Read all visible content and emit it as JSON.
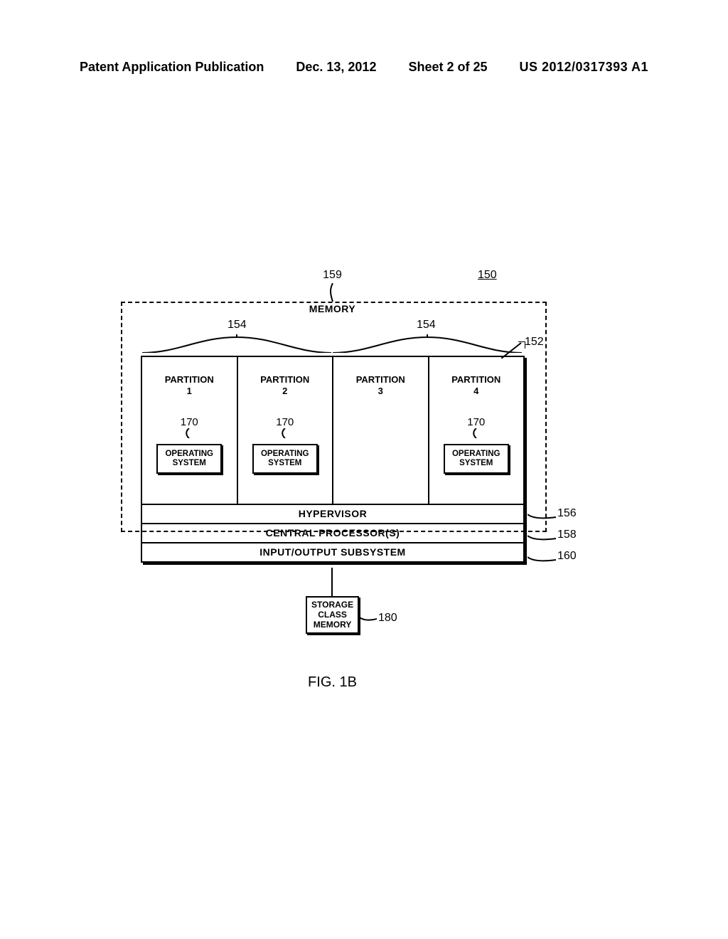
{
  "header": {
    "pub_type": "Patent Application Publication",
    "date": "Dec. 13, 2012",
    "sheet": "Sheet 2 of 25",
    "pub_number": "US 2012/0317393 A1"
  },
  "refs": {
    "r150": "150",
    "r152": "152",
    "r154": "154",
    "r156": "156",
    "r158": "158",
    "r159": "159",
    "r160": "160",
    "r170": "170",
    "r180": "180"
  },
  "labels": {
    "memory": "MEMORY",
    "hypervisor": "HYPERVISOR",
    "cpu": "CENTRAL PROCESSOR(S)",
    "io": "INPUT/OUTPUT SUBSYSTEM",
    "scm_l1": "STORAGE",
    "scm_l2": "CLASS",
    "scm_l3": "MEMORY",
    "os_l1": "OPERATING",
    "os_l2": "SYSTEM",
    "fig": "FIG. 1B"
  },
  "partitions": [
    {
      "title_l1": "PARTITION",
      "title_l2": "1",
      "has_os": true
    },
    {
      "title_l1": "PARTITION",
      "title_l2": "2",
      "has_os": true
    },
    {
      "title_l1": "PARTITION",
      "title_l2": "3",
      "has_os": false
    },
    {
      "title_l1": "PARTITION",
      "title_l2": "4",
      "has_os": true
    }
  ]
}
